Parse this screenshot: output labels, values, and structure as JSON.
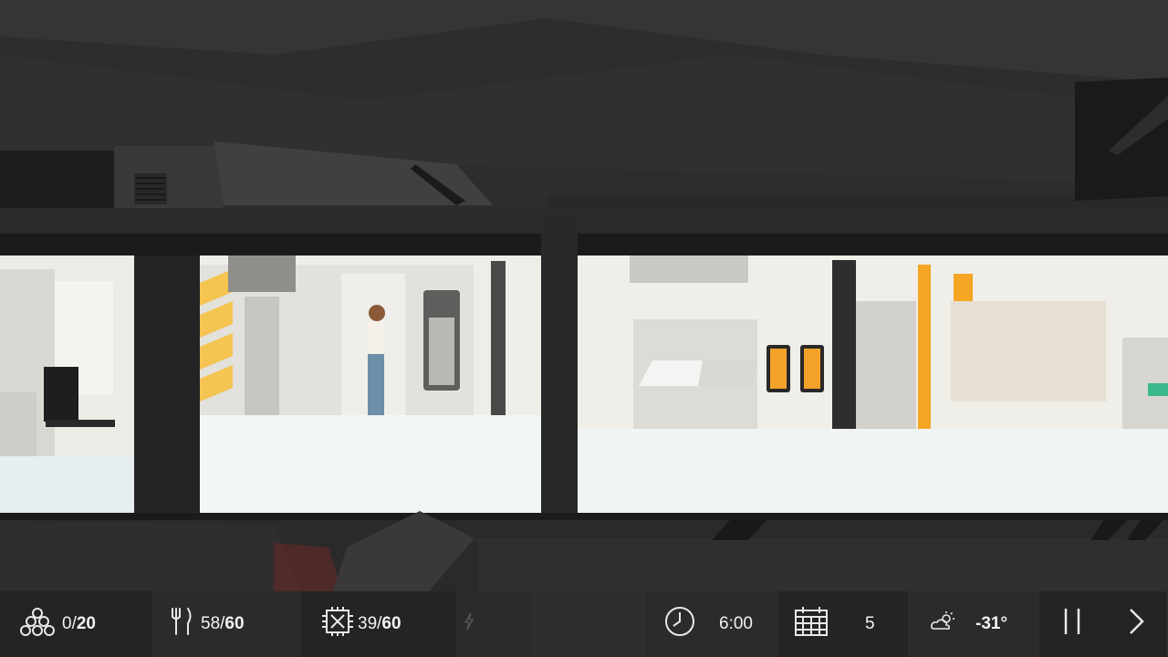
{
  "hud": {
    "survivors": {
      "icon": "people-group-icon",
      "current": "0",
      "max": "20"
    },
    "food": {
      "icon": "fork-knife-icon",
      "current": "58",
      "max": "60"
    },
    "parts": {
      "icon": "microchip-icon",
      "current": "39",
      "max": "60"
    },
    "power": {
      "icon": "lightning-icon"
    },
    "time": {
      "icon": "clock-icon",
      "value": "6:00"
    },
    "day": {
      "icon": "calendar-icon",
      "value": "5"
    },
    "weather": {
      "icon": "cloudy-sun-icon",
      "value": "-31°"
    },
    "controls": {
      "pause_icon": "pause-icon",
      "next_icon": "chevron-right-icon"
    }
  },
  "colors": {
    "bg": "#2f2d2e",
    "hud_dark": "#252325",
    "hud_mid": "#2c2a2c",
    "hazard": "#f5a623"
  }
}
